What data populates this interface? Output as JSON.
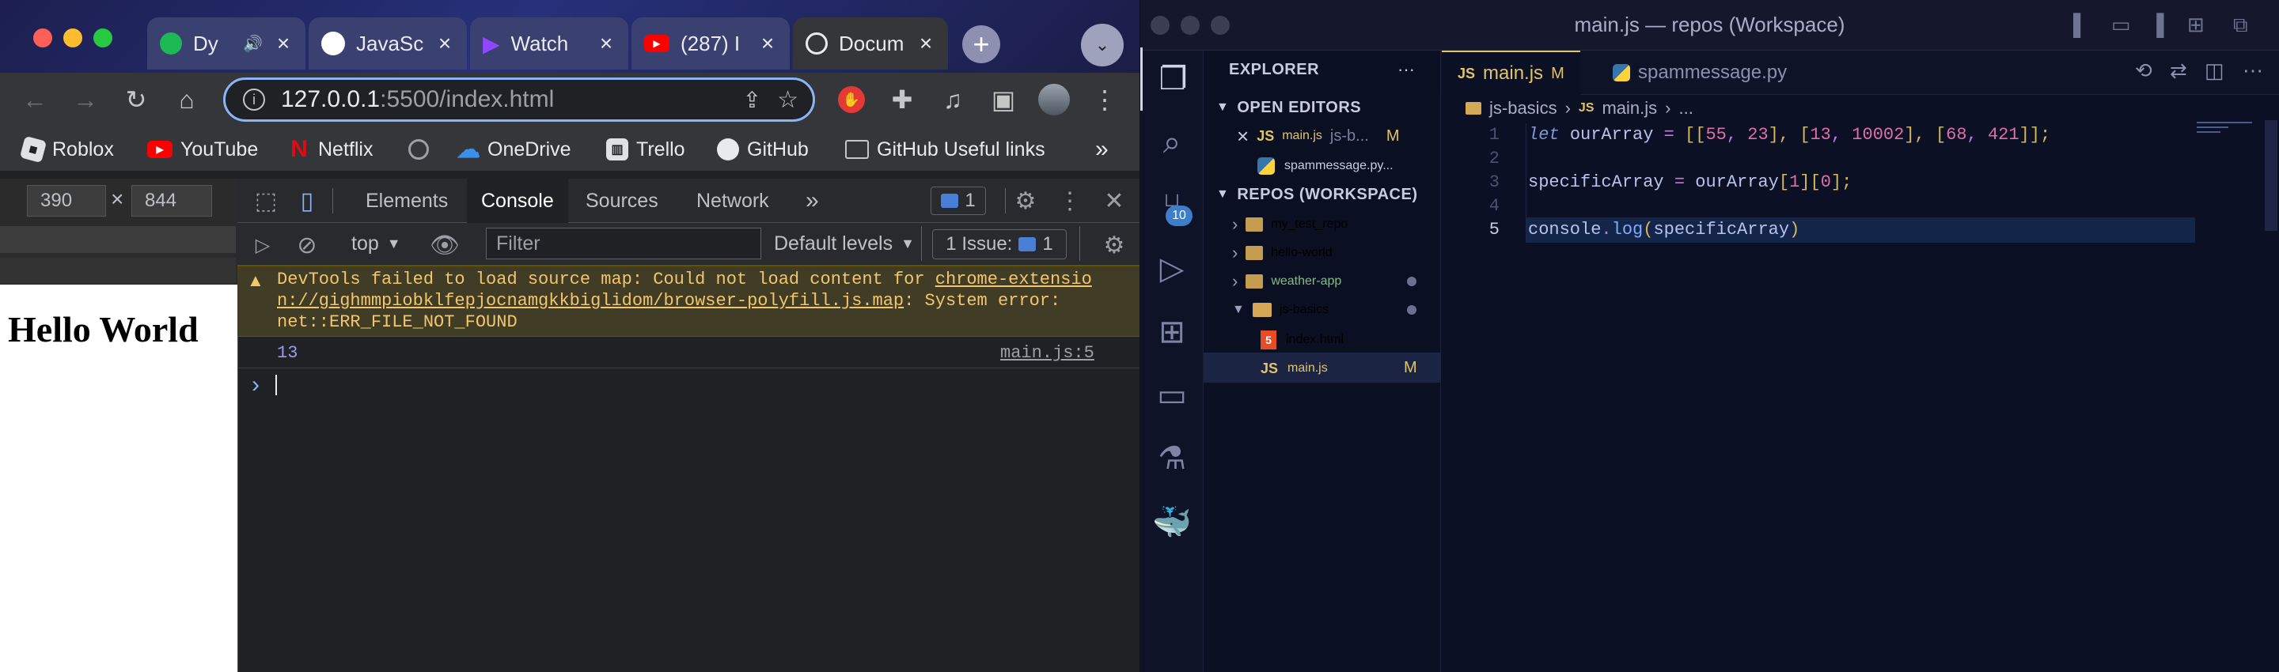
{
  "chrome": {
    "tabs": [
      {
        "title": "Dy",
        "icon": "spotify-icon",
        "audio": "speaker-icon"
      },
      {
        "title": "JavaSc",
        "icon": "github-icon"
      },
      {
        "title": "Watch",
        "icon": "play-icon"
      },
      {
        "title": "(287) I",
        "icon": "youtube-icon"
      },
      {
        "title": "Docum",
        "icon": "globe-icon",
        "active": true
      }
    ],
    "new_tab": "+",
    "tab_menu": "⌄",
    "address": {
      "host": "127.0.0.1",
      "rest": ":5500/index.html"
    },
    "bookmarks": [
      {
        "label": "Roblox"
      },
      {
        "label": "YouTube"
      },
      {
        "label": "Netflix"
      },
      {
        "label": ""
      },
      {
        "label": "OneDrive"
      },
      {
        "label": "Trello"
      },
      {
        "label": "GitHub"
      },
      {
        "label": "GitHub Useful links"
      }
    ],
    "bookmarks_more": "»",
    "device": {
      "width": "390",
      "height": "844",
      "times": "×"
    },
    "page_heading": "Hello World"
  },
  "devtools": {
    "tabs": [
      "Elements",
      "Console",
      "Sources",
      "Network"
    ],
    "active_tab": "Console",
    "more": "»",
    "message_count": "1",
    "context": "top",
    "filter_placeholder": "Filter",
    "levels": "Default levels",
    "issues_label": "1 Issue:",
    "issues_count": "1",
    "warning": {
      "prefix": "DevTools failed to load source map: Could not load content for ",
      "link_line1": "chrome-extensio",
      "link_line2": "n://gighmmpiobklfepjocnamgkkbiglidom/browser-polyfill.js.map",
      "suffix": ": System error:",
      "line3": "net::ERR_FILE_NOT_FOUND"
    },
    "log_value": "13",
    "log_source": "main.js:5",
    "prompt": "›"
  },
  "vscode": {
    "title": "main.js — repos (Workspace)",
    "explorer_label": "EXPLORER",
    "explorer_more": "···",
    "open_editors_label": "OPEN EDITORS",
    "open_editors": [
      {
        "close": "×",
        "badge": "JS",
        "name": "main.js",
        "desc": "js-b...",
        "status": "M"
      },
      {
        "badge": "",
        "name": "spammessage.py...",
        "desc": "",
        "status": ""
      }
    ],
    "workspace_label": "REPOS (WORKSPACE)",
    "folders": [
      {
        "name": "my_test_repo",
        "expanded": false,
        "dot": false
      },
      {
        "name": "hello-world",
        "expanded": false,
        "dot": false
      },
      {
        "name": "weather-app",
        "expanded": false,
        "dot": true
      },
      {
        "name": "js-basics",
        "expanded": true,
        "dot": true
      }
    ],
    "files": [
      {
        "name": "index.html",
        "badge": "5",
        "status": ""
      },
      {
        "name": "main.js",
        "badge": "JS",
        "status": "M"
      }
    ],
    "scm_badge": "10",
    "editor_tabs": [
      {
        "badge": "JS",
        "name": "main.js",
        "status": "M",
        "active": true
      },
      {
        "badge": "",
        "name": "spammessage.py",
        "status": "",
        "active": false
      }
    ],
    "breadcrumb": {
      "folder": "js-basics",
      "sep": "›",
      "file_badge": "JS",
      "file": "main.js",
      "rest": "..."
    },
    "code_lines": [
      {
        "num": "1",
        "tokens": [
          [
            "let ",
            "kw"
          ],
          [
            "ourArray",
            "var"
          ],
          [
            " = ",
            "op"
          ],
          [
            "[[",
            "br"
          ],
          [
            "55",
            "num"
          ],
          [
            ", ",
            "op"
          ],
          [
            "23",
            "num"
          ],
          [
            "], [",
            "br"
          ],
          [
            "13",
            "num"
          ],
          [
            ", ",
            "op"
          ],
          [
            "10002",
            "num"
          ],
          [
            "], [",
            "br"
          ],
          [
            "68",
            "num"
          ],
          [
            ", ",
            "op"
          ],
          [
            "421",
            "num"
          ],
          [
            "]];",
            "br"
          ]
        ]
      },
      {
        "num": "2",
        "tokens": []
      },
      {
        "num": "3",
        "tokens": [
          [
            "specificArray",
            "var"
          ],
          [
            " = ",
            "op"
          ],
          [
            "ourArray",
            "var"
          ],
          [
            "[",
            "br"
          ],
          [
            "1",
            "num"
          ],
          [
            "][",
            "br"
          ],
          [
            "0",
            "num"
          ],
          [
            "];",
            "br"
          ]
        ]
      },
      {
        "num": "4",
        "tokens": []
      },
      {
        "num": "5",
        "tokens": [
          [
            "console",
            "var"
          ],
          [
            ".",
            "op"
          ],
          [
            "log",
            "fn"
          ],
          [
            "(",
            "br"
          ],
          [
            "specificArray",
            "var"
          ],
          [
            ")",
            "br"
          ]
        ]
      }
    ],
    "colors": {
      "kw": "#7f9ad8",
      "var": "#b8c2ec",
      "op": "#c678dd",
      "br": "#d6b85a",
      "num": "#e06fa7",
      "fn": "#82aaff",
      "accent": "#e0c46c"
    }
  }
}
